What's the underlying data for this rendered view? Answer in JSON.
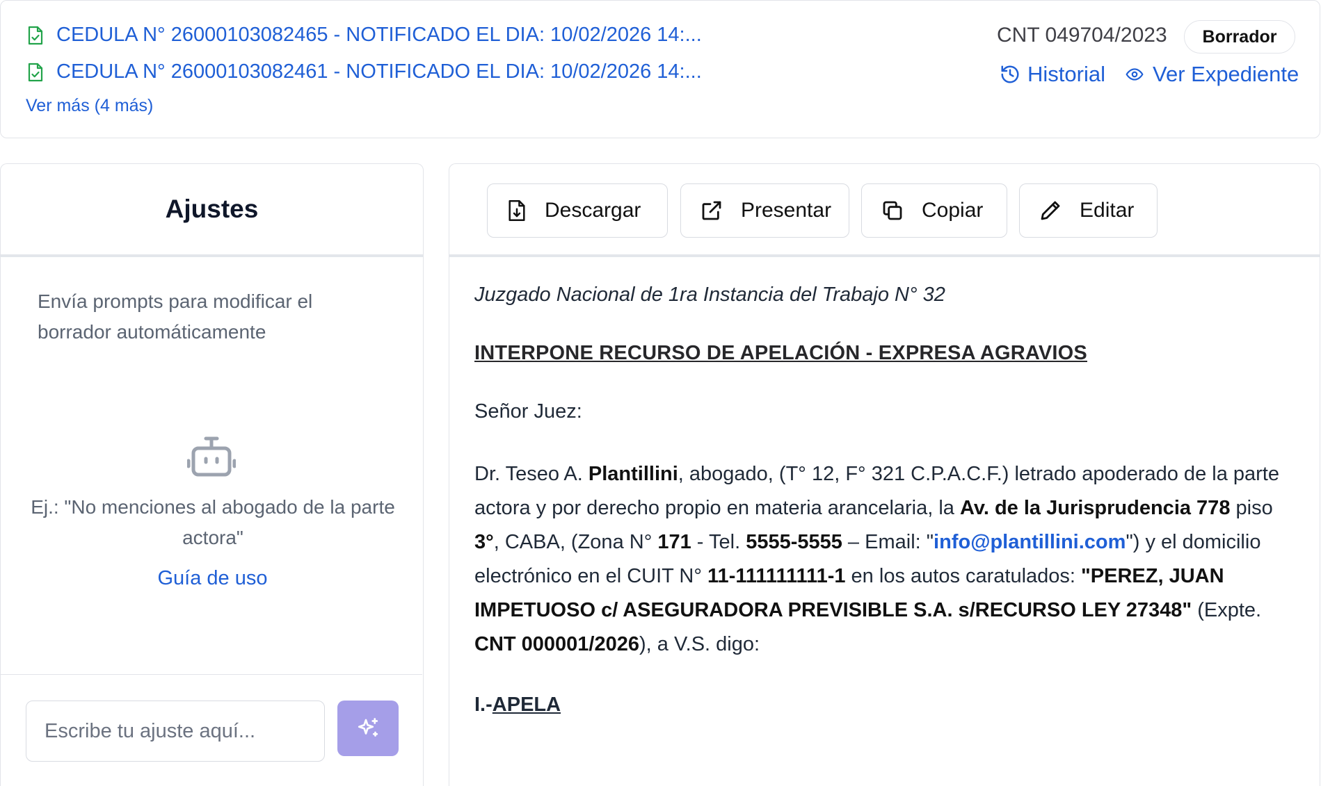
{
  "header": {
    "notifications": [
      {
        "label": "CEDULA N° 26000103082465 - NOTIFICADO EL DIA: 10/02/2026 14:..."
      },
      {
        "label": "CEDULA N° 26000103082461 - NOTIFICADO EL DIA: 10/02/2026 14:..."
      }
    ],
    "more_label": "Ver más (4 más)",
    "case_number": "CNT 049704/2023",
    "status": "Borrador",
    "history_label": "Historial",
    "view_case_label": "Ver Expediente"
  },
  "settings_panel": {
    "title": "Ajustes",
    "description": "Envía prompts para modificar el borrador automáticamente",
    "example": "Ej.: \"No menciones al abogado de la parte actora\"",
    "guide_label": "Guía de uso",
    "input_placeholder": "Escribe tu ajuste aquí..."
  },
  "toolbar": {
    "download_label": "Descargar",
    "submit_label": "Presentar",
    "copy_label": "Copiar",
    "edit_label": "Editar"
  },
  "document": {
    "court": "Juzgado Nacional de 1ra Instancia del Trabajo N° 32",
    "title": "INTERPONE RECURSO DE APELACIÓN - EXPRESA AGRAVIOS",
    "salutation": "Señor Juez:",
    "p": {
      "t01": "Dr. Teseo A. ",
      "b01": "Plantillini",
      "t02": ", abogado, (T° 12, F° 321 C.P.A.C.F.) letrado apoderado de la parte actora y por derecho propio en materia arancelaria, la ",
      "b02": "Av. de la Jurisprudencia 778",
      "t03": " piso ",
      "b03": "3°",
      "t04": ", CABA, (Zona N° ",
      "b04": "171",
      "t05": " - Tel. ",
      "b05": "5555-5555",
      "t06": " – Email: \"",
      "email": "info@plantillini.com",
      "t07": "\") y el domicilio electrónico en el CUIT N° ",
      "b06": "11-111111111-1",
      "t08": " en los autos caratulados: ",
      "b07": "\"PEREZ, JUAN IMPETUOSO c/ ASEGURADORA PREVISIBLE S.A. s/RECURSO LEY 27348\"",
      "t09": " (Expte. ",
      "b08": "CNT 000001/2026",
      "t10": "), a V.S. digo:"
    },
    "section_prefix": "I.-",
    "section_title": "APELA"
  }
}
